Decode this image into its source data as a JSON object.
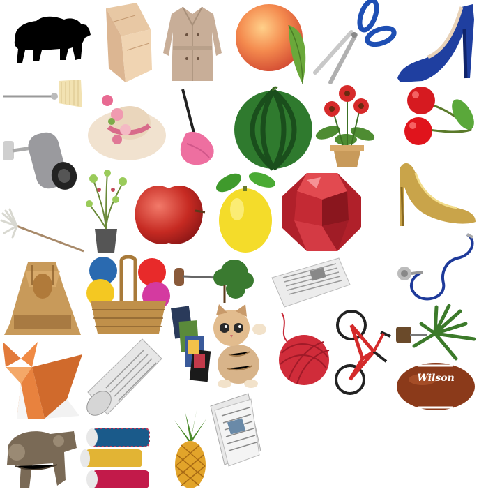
{
  "image": {
    "description_items": [
      "bear-silhouette",
      "clutch-purse",
      "trench-coat",
      "peach",
      "scissors",
      "blue-high-heel",
      "wall-lamp-fringe",
      "floral-sun-hat",
      "pink-feather-duster",
      "watermelon",
      "gerbera-flower-pot",
      "cherries",
      "spotlight-lamp",
      "bonsai-sprouts-pot",
      "red-apple",
      "lemon",
      "red-gemstone",
      "gold-high-heel",
      "mop",
      "stethoscope",
      "sphinx-statue",
      "yarn-basket",
      "potted-tree-lamp",
      "newspaper-flat",
      "origami-fox",
      "rolled-newspaper",
      "tarot-cards-fan",
      "kitten",
      "red-yarn-ball",
      "red-bicycle",
      "hanging-plant",
      "american-football",
      "bronze-cannon-ornament",
      "thread-spools",
      "pineapple",
      "newspaper-pile"
    ],
    "colors": {
      "background": "#ffffff",
      "bear": "#000000",
      "blue_shoe": "#1f3fa0",
      "gold_shoe": "#c9a44a",
      "peach": "#f07a4a",
      "watermelon": "#2f7a2e",
      "lemon": "#f4dc2a",
      "gem": "#c0242c",
      "football": "#8b3a1a",
      "yarn_red": "#d02c3a"
    },
    "football_brand": "Wilson"
  }
}
